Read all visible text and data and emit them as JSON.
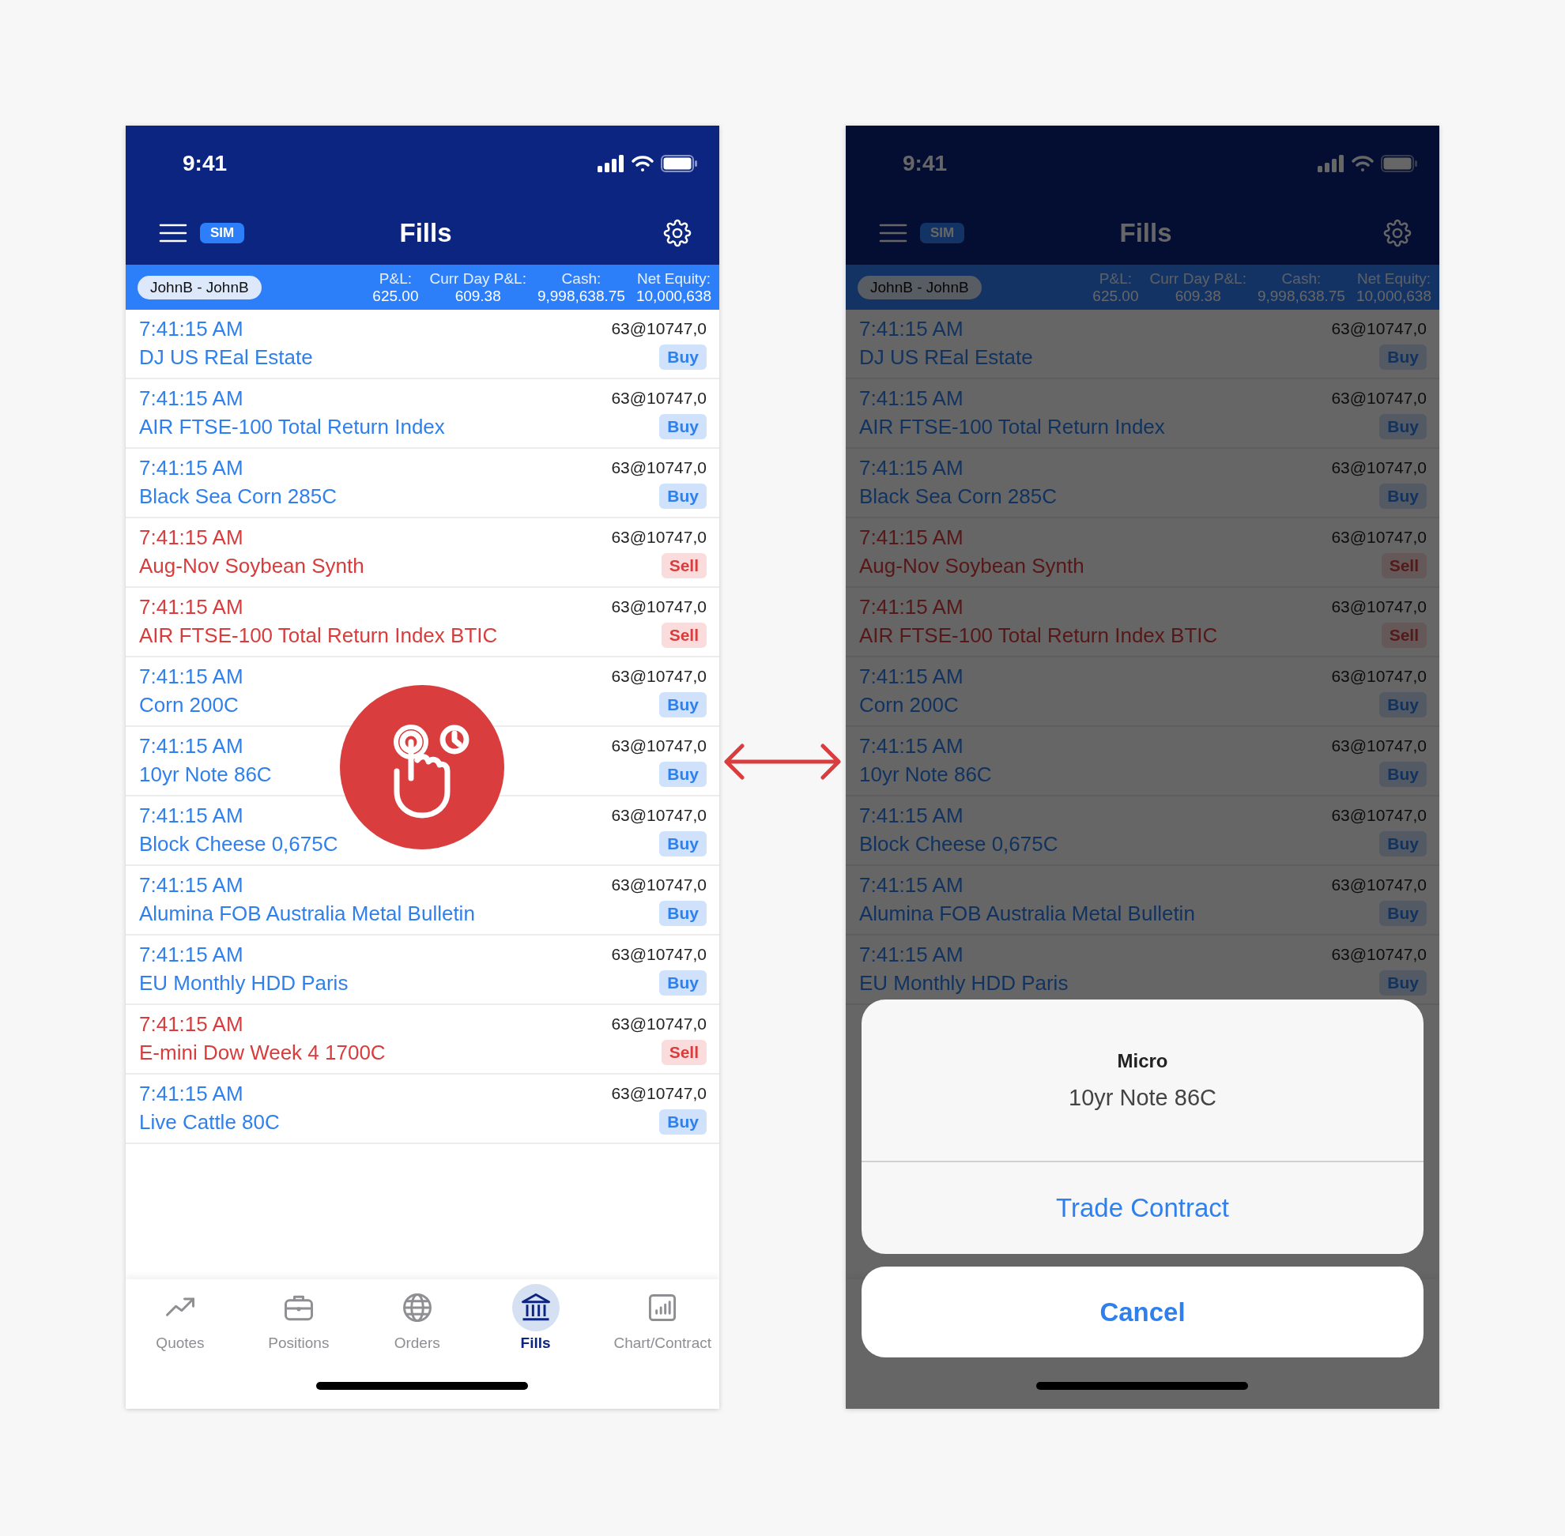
{
  "phones": [
    {
      "dimmed": false,
      "status_bar": {
        "time": "9:41"
      },
      "nav_bar": {
        "title": "Fills",
        "badge": "SIM"
      },
      "account": {
        "name": "JohnB - JohnB",
        "stats": [
          {
            "label": "P&L:",
            "value": "625.00"
          },
          {
            "label": "Curr Day P&L:",
            "value": "609.38"
          },
          {
            "label": "Cash:",
            "value": "9,998,638.75"
          },
          {
            "label": "Net Equity:",
            "value": "10,000,638"
          }
        ]
      },
      "fills": [
        {
          "time": "7:41:15 AM",
          "contract": "DJ US REal Estate",
          "quantity": "63@10747,0",
          "side": "Buy",
          "kind": "buy"
        },
        {
          "time": "7:41:15 AM",
          "contract": "AIR FTSE-100 Total Return Index",
          "quantity": "63@10747,0",
          "side": "Buy",
          "kind": "buy"
        },
        {
          "time": "7:41:15 AM",
          "contract": "Black Sea Corn 285C",
          "quantity": "63@10747,0",
          "side": "Buy",
          "kind": "buy"
        },
        {
          "time": "7:41:15 AM",
          "contract": "Aug-Nov Soybean Synth",
          "quantity": "63@10747,0",
          "side": "Sell",
          "kind": "sell"
        },
        {
          "time": "7:41:15 AM",
          "contract": "AIR FTSE-100 Total Return Index BTIC",
          "quantity": "63@10747,0",
          "side": "Sell",
          "kind": "sell"
        },
        {
          "time": "7:41:15 AM",
          "contract": "Corn 200C",
          "quantity": "63@10747,0",
          "side": "Buy",
          "kind": "buy"
        },
        {
          "time": "7:41:15 AM",
          "contract": "10yr Note 86C",
          "quantity": "63@10747,0",
          "side": "Buy",
          "kind": "buy"
        },
        {
          "time": "7:41:15 AM",
          "contract": "Block Cheese 0,675C",
          "quantity": "63@10747,0",
          "side": "Buy",
          "kind": "buy"
        },
        {
          "time": "7:41:15 AM",
          "contract": "Alumina FOB Australia Metal Bulletin",
          "quantity": "63@10747,0",
          "side": "Buy",
          "kind": "buy"
        },
        {
          "time": "7:41:15 AM",
          "contract": "EU Monthly HDD Paris",
          "quantity": "63@10747,0",
          "side": "Buy",
          "kind": "buy"
        },
        {
          "time": "7:41:15 AM",
          "contract": "E-mini Dow Week 4 1700C",
          "quantity": "63@10747,0",
          "side": "Sell",
          "kind": "sell"
        },
        {
          "time": "7:41:15 AM",
          "contract": "Live Cattle 80C",
          "quantity": "63@10747,0",
          "side": "Buy",
          "kind": "buy"
        }
      ],
      "tabs": [
        {
          "label": "Quotes",
          "selected": false
        },
        {
          "label": "Positions",
          "selected": false
        },
        {
          "label": "Orders",
          "selected": false
        },
        {
          "label": "Fills",
          "selected": true
        },
        {
          "label": "Chart/Contract",
          "selected": false
        }
      ]
    },
    {
      "dimmed": true,
      "status_bar": {
        "time": "9:41"
      },
      "nav_bar": {
        "title": "Fills",
        "badge": "SIM"
      },
      "account": {
        "name": "JohnB - JohnB",
        "stats": [
          {
            "label": "P&L:",
            "value": "625.00"
          },
          {
            "label": "Curr Day P&L:",
            "value": "609.38"
          },
          {
            "label": "Cash:",
            "value": "9,998,638.75"
          },
          {
            "label": "Net Equity:",
            "value": "10,000,638"
          }
        ]
      },
      "fills": [
        {
          "time": "7:41:15 AM",
          "contract": "DJ US REal Estate",
          "quantity": "63@10747,0",
          "side": "Buy",
          "kind": "buy"
        },
        {
          "time": "7:41:15 AM",
          "contract": "AIR FTSE-100 Total Return Index",
          "quantity": "63@10747,0",
          "side": "Buy",
          "kind": "buy"
        },
        {
          "time": "7:41:15 AM",
          "contract": "Black Sea Corn 285C",
          "quantity": "63@10747,0",
          "side": "Buy",
          "kind": "buy"
        },
        {
          "time": "7:41:15 AM",
          "contract": "Aug-Nov Soybean Synth",
          "quantity": "63@10747,0",
          "side": "Sell",
          "kind": "sell"
        },
        {
          "time": "7:41:15 AM",
          "contract": "AIR FTSE-100 Total Return Index BTIC",
          "quantity": "63@10747,0",
          "side": "Sell",
          "kind": "sell"
        },
        {
          "time": "7:41:15 AM",
          "contract": "Corn 200C",
          "quantity": "63@10747,0",
          "side": "Buy",
          "kind": "buy"
        },
        {
          "time": "7:41:15 AM",
          "contract": "10yr Note 86C",
          "quantity": "63@10747,0",
          "side": "Buy",
          "kind": "buy"
        },
        {
          "time": "7:41:15 AM",
          "contract": "Block Cheese 0,675C",
          "quantity": "63@10747,0",
          "side": "Buy",
          "kind": "buy"
        },
        {
          "time": "7:41:15 AM",
          "contract": "Alumina FOB Australia Metal Bulletin",
          "quantity": "63@10747,0",
          "side": "Buy",
          "kind": "buy"
        },
        {
          "time": "7:41:15 AM",
          "contract": "EU Monthly HDD Paris",
          "quantity": "63@10747,0",
          "side": "Buy",
          "kind": "buy"
        }
      ],
      "action_sheet": {
        "title": "Micro",
        "message": "10yr Note 86C",
        "actions": [
          "Trade Contract"
        ],
        "cancel": "Cancel"
      }
    }
  ]
}
